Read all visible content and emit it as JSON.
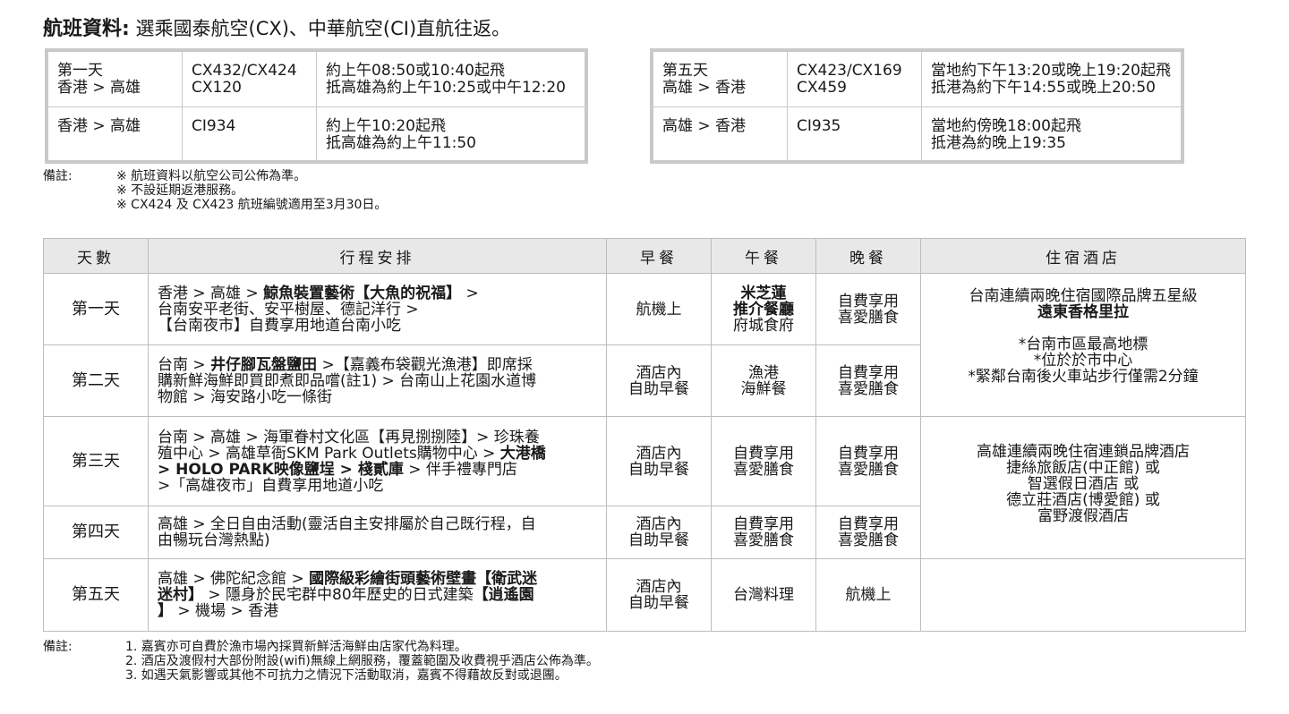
{
  "header": {
    "title_bold": "航班資料:",
    "title_rest": "選乘國泰航空(CX)、中華航空(CI)直航往返。"
  },
  "flights_left": [
    {
      "day_line1": "第一天",
      "day_line2": "香港 > 高雄",
      "flight_line1": "CX432/CX424",
      "flight_line2": "CX120",
      "time_line1": "約上午08:50或10:40起飛",
      "time_line2": "抵高雄為約上午10:25或中午12:20"
    },
    {
      "day_line1": "香港 > 高雄",
      "day_line2": "",
      "flight_line1": "CI934",
      "flight_line2": "",
      "time_line1": "約上午10:20起飛",
      "time_line2": "抵高雄為約上午11:50"
    }
  ],
  "flights_right": [
    {
      "day_line1": "第五天",
      "day_line2": "高雄 > 香港",
      "flight_line1": "CX423/CX169",
      "flight_line2": "CX459",
      "time_line1": "當地約下午13:20或晚上19:20起飛",
      "time_line2": "抵港為約下午14:55或晚上20:50"
    },
    {
      "day_line1": "高雄 > 香港",
      "day_line2": "",
      "flight_line1": "CI935",
      "flight_line2": "",
      "time_line1": "當地約傍晚18:00起飛",
      "time_line2": "抵港為約晚上19:35"
    }
  ],
  "flight_notes": {
    "label": "備註:",
    "lines": [
      "※ 航班資料以航空公司公佈為準。",
      "※ 不設延期返港服務。",
      "※ CX424 及 CX423 航班編號適用至3月30日。"
    ]
  },
  "itinerary": {
    "headers": [
      "天數",
      "行程安排",
      "早餐",
      "午餐",
      "晚餐",
      "住宿酒店"
    ],
    "rows": [
      {
        "day": "第一天",
        "plan": [
          [
            {
              "t": "香港 > 高雄 > "
            },
            {
              "t": "鯨魚裝置藝術【大魚的祝福】",
              "b": true
            },
            {
              "t": " >"
            }
          ],
          [
            {
              "t": "台南安平老街、安平樹屋、德記洋行 >"
            }
          ],
          [
            {
              "t": "【台南夜市】自費享用地道台南小吃"
            }
          ]
        ],
        "breakfast": [
          "航機上"
        ],
        "lunch": [
          {
            "t": "米芝蓮",
            "b": true
          },
          {
            "t": "推介餐廳",
            "b": true
          },
          {
            "t": "府城食府"
          }
        ],
        "dinner": [
          "自費享用",
          "喜愛膳食"
        ]
      },
      {
        "day": "第二天",
        "plan": [
          [
            {
              "t": "台南 > "
            },
            {
              "t": "井仔腳瓦盤鹽田",
              "b": true
            },
            {
              "t": " >【嘉義布袋觀光漁港】即席採"
            }
          ],
          [
            {
              "t": "購新鮮海鮮即買即煮即品嚐(註1) > 台南山上花園水道博"
            }
          ],
          [
            {
              "t": "物館 > 海安路小吃一條街"
            }
          ]
        ],
        "breakfast": [
          "酒店內",
          "自助早餐"
        ],
        "lunch": [
          {
            "t": "漁港"
          },
          {
            "t": "海鮮餐"
          }
        ],
        "dinner": [
          "自費享用",
          "喜愛膳食"
        ]
      },
      {
        "day": "第三天",
        "plan": [
          [
            {
              "t": "台南 > 高雄 > 海軍眷村文化區【再見捌捌陸】> 珍珠養"
            }
          ],
          [
            {
              "t": "殖中心 > 高雄草衙SKM Park Outlets購物中心 > "
            },
            {
              "t": "大港橋",
              "b": true
            }
          ],
          [
            {
              "t": "> HOLO PARK映像鹽埕 > 棧貳庫",
              "b": true
            },
            {
              "t": " > 伴手禮專門店"
            }
          ],
          [
            {
              "t": ">「高雄夜市」自費享用地道小吃"
            }
          ]
        ],
        "breakfast": [
          "酒店內",
          "自助早餐"
        ],
        "lunch": [
          {
            "t": "自費享用"
          },
          {
            "t": "喜愛膳食"
          }
        ],
        "dinner": [
          "自費享用",
          "喜愛膳食"
        ]
      },
      {
        "day": "第四天",
        "plan": [
          [
            {
              "t": "高雄 > 全日自由活動(靈活自主安排屬於自己既行程，自"
            }
          ],
          [
            {
              "t": "由暢玩台灣熱點)"
            }
          ]
        ],
        "breakfast": [
          "酒店內",
          "自助早餐"
        ],
        "lunch": [
          {
            "t": "自費享用"
          },
          {
            "t": "喜愛膳食"
          }
        ],
        "dinner": [
          "自費享用",
          "喜愛膳食"
        ]
      },
      {
        "day": "第五天",
        "plan": [
          [
            {
              "t": "高雄 > 佛陀紀念館 > "
            },
            {
              "t": "國際級彩繪街頭藝術壁畫【衛武迷",
              "b": true
            }
          ],
          [
            {
              "t": "迷村】",
              "b": true
            },
            {
              "t": " > 隱身於民宅群中80年歷史的日式建築"
            },
            {
              "t": "【逍遙園",
              "b": true
            }
          ],
          [
            {
              "t": "】",
              "b": true
            },
            {
              "t": " > 機場 > 香港"
            }
          ]
        ],
        "breakfast": [
          "酒店內",
          "自助早餐"
        ],
        "lunch": [
          {
            "t": "台灣料理"
          }
        ],
        "dinner": [
          "航機上"
        ]
      }
    ],
    "hotels": {
      "tainan": {
        "line1": "台南連續兩晚住宿國際品牌五星級",
        "name": "遠東香格里拉",
        "points": [
          "*台南市區最高地標",
          "*位於於市中心",
          "*緊鄰台南後火車站步行僅需2分鐘"
        ]
      },
      "kaohsiung": {
        "lines": [
          "高雄連續兩晚住宿連鎖品牌酒店",
          "捷絲旅飯店(中正館) 或",
          "智選假日酒店 或",
          "德立莊酒店(博愛館) 或",
          "富野渡假酒店"
        ]
      }
    }
  },
  "bottom_notes": {
    "label": "備註:",
    "lines": [
      "1. 嘉賓亦可自費於漁市場內採買新鮮活海鮮由店家代為料理。",
      "2. 酒店及渡假村大部份附設(wifi)無線上網服務，覆蓋範圍及收費視乎酒店公佈為準。",
      "3. 如遇天氣影響或其他不可抗力之情況下活動取消，嘉賓不得藉故反對或退團。"
    ]
  }
}
